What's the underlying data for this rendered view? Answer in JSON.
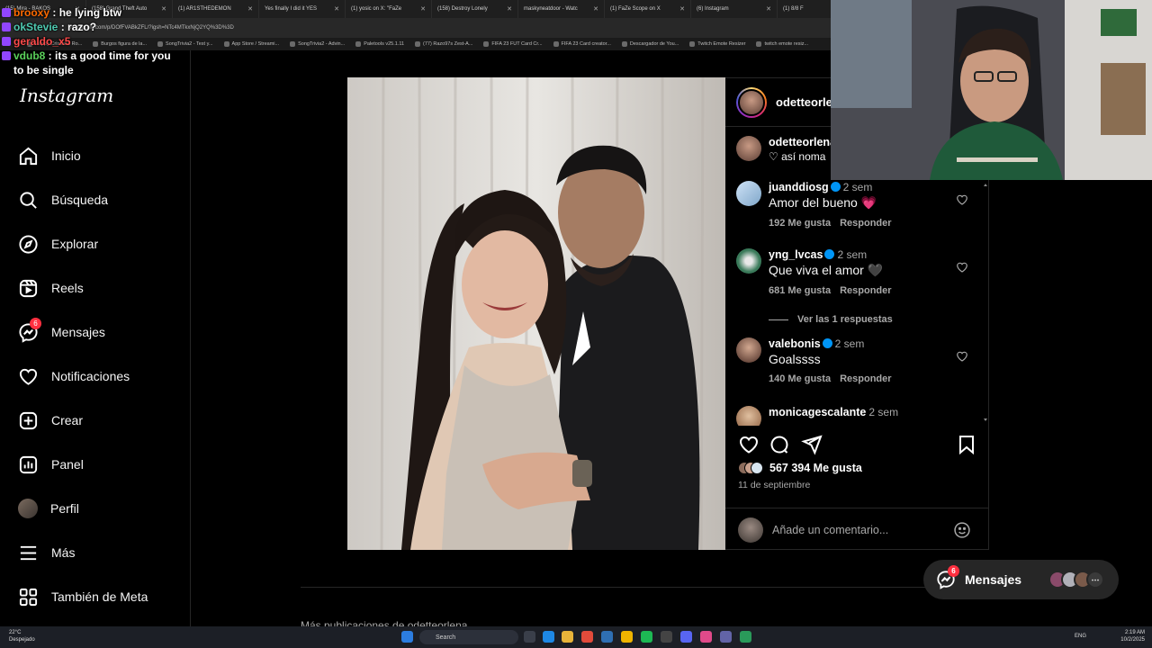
{
  "browser": {
    "tabs": [
      "(15) Mira - BAKOS",
      "(158) Grand Theft Auto",
      "(1) AR1STHEDEMON",
      "Yes finally I did it YES",
      "(1) yosic on X: \"FaZe",
      "(158) Destroy Lonely",
      "maskyneatdoor - Watc",
      "(1) FaZe Scope on X",
      "(6) Instagram",
      "(1) 8/8 F"
    ],
    "url": "instagram.com/p/DOfFVABkZFL/?igsh=NTc4MTkxNjQ2YQ%3D%3D",
    "bookmarks": [
      "Happy Cristiano Ro...",
      "Burgos figura de la...",
      "SongTrivia2 - Test y...",
      "App Store / Streami...",
      "SongTrivia2 - Advin...",
      "Paletools v25.1.11",
      "(77) Razo97s Zest-A...",
      "FIFA 23 FUT Card Cr...",
      "FIFA 23 Card creator...",
      "Descargador de You...",
      "Twitch Emote Resizer",
      "twitch emote resiz..."
    ]
  },
  "chat": [
    {
      "user": "brooxy",
      "color": "#ff6a00",
      "message": "he lying btw"
    },
    {
      "user": "okStevie",
      "color": "#4ec9b0",
      "message": "razo?"
    },
    {
      "user": "geraldo_x5",
      "color": "#ff4a4a",
      "message": ""
    },
    {
      "user": "vdub8",
      "color": "#5ad15a",
      "message": "its a good time for you to be single"
    }
  ],
  "sidebar": {
    "logo": "Instagram",
    "items": [
      {
        "label": "Inicio",
        "icon": "home-icon"
      },
      {
        "label": "Búsqueda",
        "icon": "search-icon"
      },
      {
        "label": "Explorar",
        "icon": "compass-icon"
      },
      {
        "label": "Reels",
        "icon": "reels-icon"
      },
      {
        "label": "Mensajes",
        "icon": "messenger-icon",
        "badge": "6"
      },
      {
        "label": "Notificaciones",
        "icon": "heart-icon"
      },
      {
        "label": "Crear",
        "icon": "plus-square-icon"
      },
      {
        "label": "Panel",
        "icon": "dashboard-icon"
      },
      {
        "label": "Perfil",
        "icon": "avatar"
      },
      {
        "label": "Más",
        "icon": "menu-icon"
      },
      {
        "label": "También de Meta",
        "icon": "meta-icon"
      }
    ]
  },
  "post": {
    "author": "odetteorlena",
    "caption_author": "odetteorlena",
    "caption": "♡ así noma",
    "comments": [
      {
        "user": "juanddiosg",
        "verified": true,
        "time": "2 sem",
        "text": "Amor del bueno 💗",
        "likes": "192 Me gusta",
        "reply": "Responder"
      },
      {
        "user": "yng_lvcas",
        "verified": true,
        "time": "2 sem",
        "text": "Que viva el amor 🖤",
        "likes": "681 Me gusta",
        "reply": "Responder"
      },
      {
        "user": "valebonis",
        "verified": true,
        "time": "2 sem",
        "text": "Goalssss",
        "likes": "140 Me gusta",
        "reply": "Responder"
      },
      {
        "user": "monicagescalante",
        "verified": false,
        "time": "2 sem",
        "text": "",
        "likes": "",
        "reply": ""
      }
    ],
    "view_replies": "Ver las 1 respuestas",
    "likes": "567 394 Me gusta",
    "date": "11 de septiembre",
    "comment_placeholder": "Añade un comentario..."
  },
  "more_from": "Más publicaciones de odetteorlena",
  "messages_pill": {
    "label": "Mensajes",
    "badge": "6"
  },
  "taskbar": {
    "temp": "22°C",
    "weather": "Despejado",
    "search": "Search",
    "lang": "ENG",
    "time": "2:19 AM",
    "date": "10/2/2025"
  }
}
